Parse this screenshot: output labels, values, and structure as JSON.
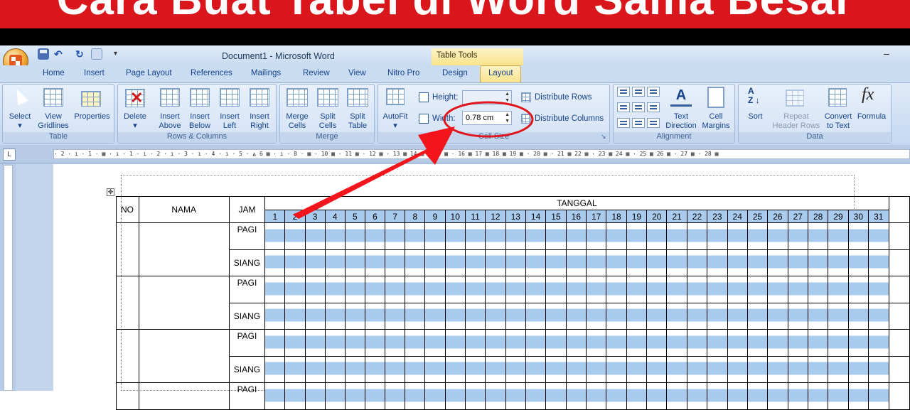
{
  "banner": {
    "title": "Cara Buat Tabel di Word Sama Besar"
  },
  "window": {
    "title": "Document1 - Microsoft Word",
    "context_tab_group": "Table Tools",
    "minimize_glyph": "–"
  },
  "quick_access": {
    "save_icon": "save-icon",
    "undo_glyph": "↶",
    "redo_glyph": "↻",
    "more_glyph": "▾"
  },
  "tabs": [
    {
      "label": "Home"
    },
    {
      "label": "Insert"
    },
    {
      "label": "Page Layout"
    },
    {
      "label": "References"
    },
    {
      "label": "Mailings"
    },
    {
      "label": "Review"
    },
    {
      "label": "View"
    },
    {
      "label": "Nitro Pro"
    },
    {
      "label": "Design"
    },
    {
      "label": "Layout"
    }
  ],
  "active_tab": "Layout",
  "ribbon": {
    "table": {
      "label": "Table",
      "select": "Select",
      "select_arrow": "▾",
      "view_gridlines_1": "View",
      "view_gridlines_2": "Gridlines",
      "properties": "Properties"
    },
    "rows_columns": {
      "label": "Rows & Columns",
      "delete": "Delete",
      "delete_arrow": "▾",
      "insert_above_1": "Insert",
      "insert_above_2": "Above",
      "insert_below_1": "Insert",
      "insert_below_2": "Below",
      "insert_left_1": "Insert",
      "insert_left_2": "Left",
      "insert_right_1": "Insert",
      "insert_right_2": "Right"
    },
    "merge": {
      "label": "Merge",
      "merge_cells_1": "Merge",
      "merge_cells_2": "Cells",
      "split_cells_1": "Split",
      "split_cells_2": "Cells",
      "split_table_1": "Split",
      "split_table_2": "Table"
    },
    "cell_size": {
      "label": "Cell Size",
      "autofit": "AutoFit",
      "autofit_arrow": "▾",
      "height_label": "Height:",
      "height_value": "",
      "width_label": "Width:",
      "width_value": "0.78 cm",
      "distribute_rows": "Distribute Rows",
      "distribute_columns": "Distribute Columns"
    },
    "alignment": {
      "label": "Alignment",
      "text_direction_1": "Text",
      "text_direction_2": "Direction",
      "cell_margins_1": "Cell",
      "cell_margins_2": "Margins"
    },
    "data": {
      "label": "Data",
      "sort": "Sort",
      "repeat_header_1": "Repeat",
      "repeat_header_2": "Header Rows",
      "convert_1": "Convert",
      "convert_2": "to Text",
      "formula": "Formula"
    }
  },
  "ruler": {
    "text": "· 2 · ı · 1 · ▦ · ı · 1 · ı · 2 · ı · 3 · ı · 4 · ı · 5 · ◭ 6 ▦ · ı · 8 · ▦ · 10 ▦ · 11 ▦ · 12 ▦ · 13 ▦ 14 ▦ · 15 ▦ · 16 ▦ 17 ▦ 18 ▦ 19 ▦ · 20 ▦ · 21 ▦ 22 ▦ · 23 ▦ 24 ▦ · 25 ▦ 26 ▦ · 27 ▦ · 28 ▦"
  },
  "table": {
    "header": {
      "no": "NO",
      "nama": "NAMA",
      "jam": "JAM",
      "tanggal": "TANGGAL"
    },
    "days": [
      "1",
      "2",
      "3",
      "4",
      "5",
      "6",
      "7",
      "8",
      "9",
      "10",
      "11",
      "12",
      "13",
      "14",
      "15",
      "16",
      "17",
      "18",
      "19",
      "20",
      "21",
      "22",
      "23",
      "24",
      "25",
      "26",
      "27",
      "28",
      "29",
      "30",
      "31"
    ],
    "rows": [
      {
        "jam": "PAGI"
      },
      {
        "jam": "SIANG"
      },
      {
        "jam": "PAGI"
      },
      {
        "jam": "SIANG"
      },
      {
        "jam": "PAGI"
      },
      {
        "jam": "SIANG"
      },
      {
        "jam": "PAGI"
      }
    ]
  },
  "annotation": {
    "highlight_color": "#e0161c",
    "arrow_color": "#f2161c"
  }
}
